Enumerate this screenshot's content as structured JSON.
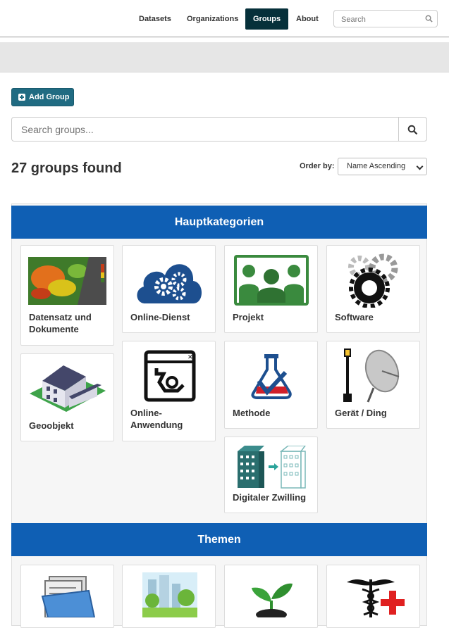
{
  "nav": {
    "links": [
      "Datasets",
      "Organizations",
      "Groups",
      "About"
    ],
    "search_placeholder": "Search"
  },
  "actions": {
    "add_group_label": "Add Group"
  },
  "search": {
    "placeholder": "Search groups..."
  },
  "results": {
    "count_text": "27 groups found",
    "order_label": "Order by:",
    "order_selected": "Name Ascending"
  },
  "sections": [
    {
      "title": "Hauptkategorien",
      "groups": [
        {
          "label": "Datensatz und Dokumente",
          "icon": "thermal-map-icon"
        },
        {
          "label": "Online-Dienst",
          "icon": "cloud-gears-icon"
        },
        {
          "label": "Projekt",
          "icon": "people-group-icon"
        },
        {
          "label": "Software",
          "icon": "gears-icon"
        },
        {
          "label": "Geoobjekt",
          "icon": "house-icon"
        },
        {
          "label": "Online-Anwendung",
          "icon": "app-window-gear-icon"
        },
        {
          "label": "Methode",
          "icon": "flask-check-icon"
        },
        {
          "label": "Gerät / Ding",
          "icon": "lamp-dish-icon"
        },
        {
          "label": "Digitaler Zwilling",
          "icon": "building-twin-icon"
        }
      ]
    },
    {
      "title": "Themen",
      "groups": [
        {
          "label": "",
          "icon": "folder-documents-icon"
        },
        {
          "label": "",
          "icon": "city-park-icon"
        },
        {
          "label": "",
          "icon": "sprout-icon"
        },
        {
          "label": "",
          "icon": "caduceus-cross-icon"
        }
      ]
    }
  ],
  "colors": {
    "nav_active": "#06303a",
    "button": "#206b82",
    "section_bar": "#0f5fb4"
  }
}
